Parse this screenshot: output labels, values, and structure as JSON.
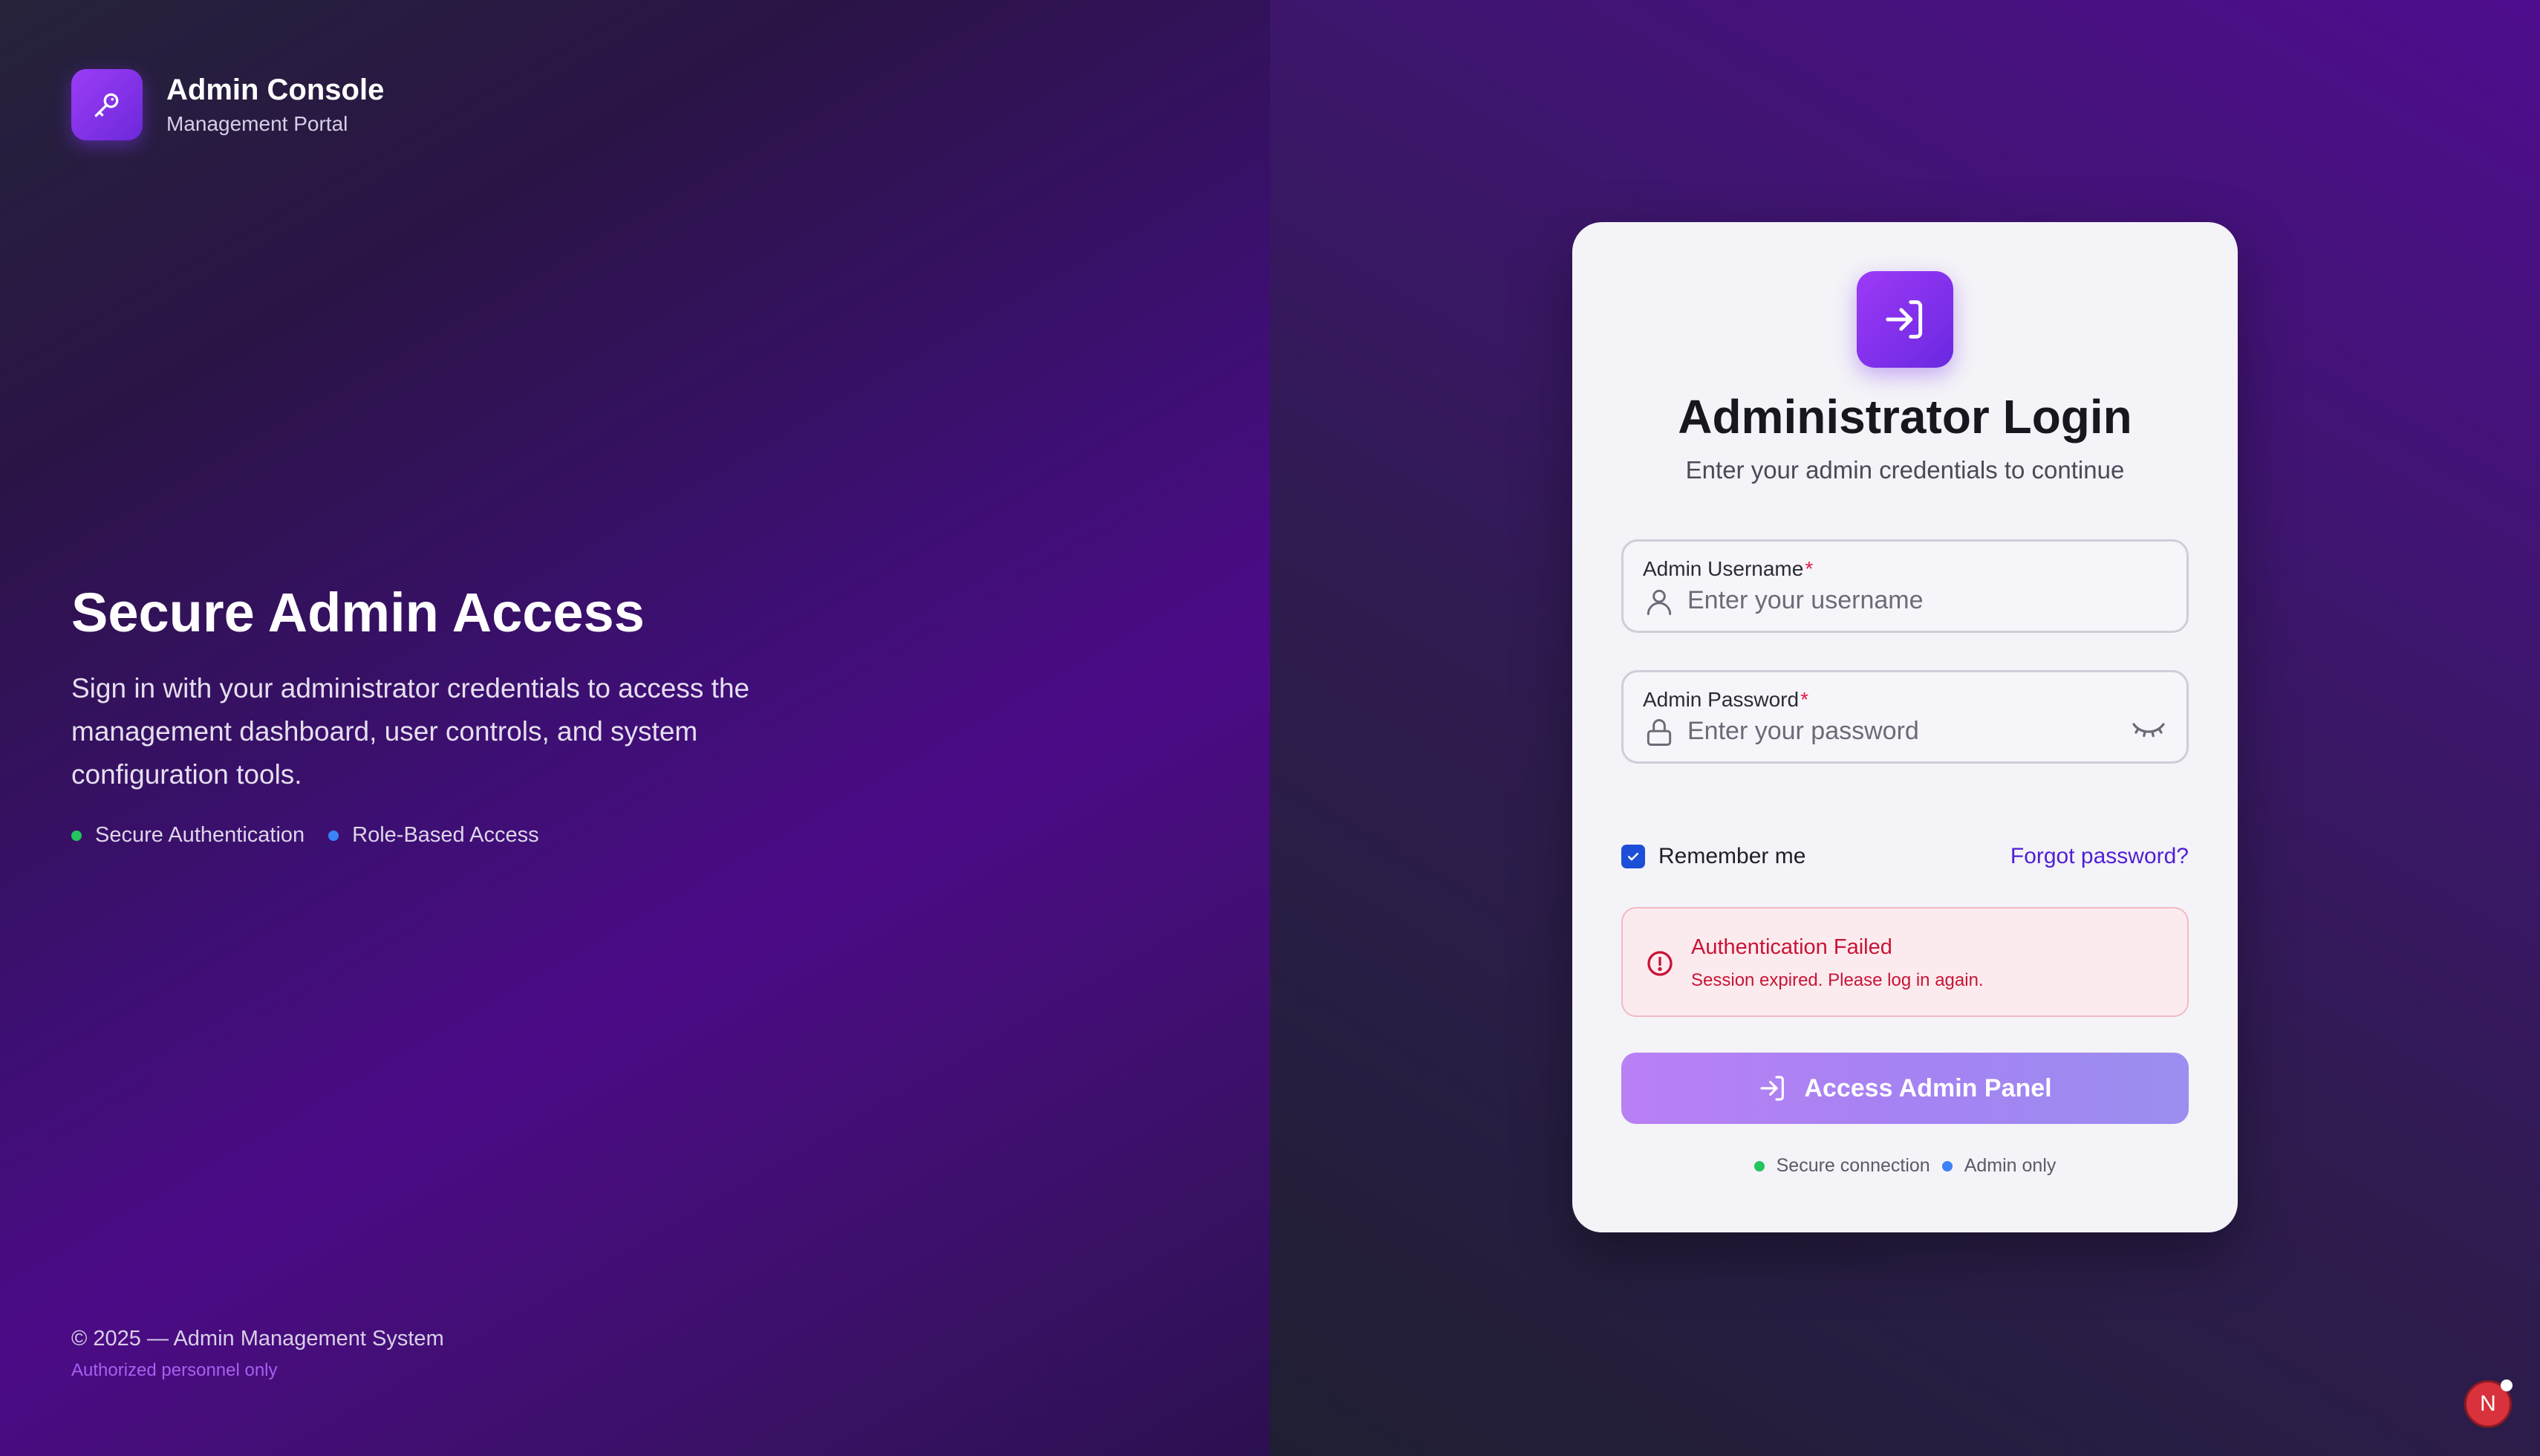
{
  "brand": {
    "title": "Admin Console",
    "subtitle": "Management Portal",
    "icon": "key-icon"
  },
  "hero": {
    "title": "Secure Admin Access",
    "description": "Sign in with your administrator credentials to access the management dashboard, user controls, and system configuration tools.",
    "badges": [
      {
        "label": "Secure Authentication",
        "color": "#22c55e"
      },
      {
        "label": "Role-Based Access",
        "color": "#3b82f6"
      }
    ]
  },
  "footer": {
    "copyright": "© 2025 — Admin Management System",
    "note": "Authorized personnel only"
  },
  "card": {
    "icon": "login-arrow-icon",
    "title": "Administrator Login",
    "subtitle": "Enter your admin credentials to continue",
    "username": {
      "label": "Admin Username",
      "required_mark": "*",
      "placeholder": "Enter your username",
      "value": ""
    },
    "password": {
      "label": "Admin Password",
      "required_mark": "*",
      "placeholder": "Enter your password",
      "value": ""
    },
    "remember": {
      "label": "Remember me",
      "checked": true
    },
    "forgot_label": "Forgot password?",
    "alert": {
      "title": "Authentication Failed",
      "message": "Session expired. Please log in again."
    },
    "submit_label": "Access Admin Panel",
    "status": [
      {
        "label": "Secure connection",
        "color": "#22c55e"
      },
      {
        "label": "Admin only",
        "color": "#3b82f6"
      }
    ]
  },
  "avatar": {
    "initial": "N"
  },
  "colors": {
    "accent": "#7c3aed",
    "error": "#c81436",
    "link": "#4f1fd6",
    "checkbox": "#1d4ed8"
  }
}
